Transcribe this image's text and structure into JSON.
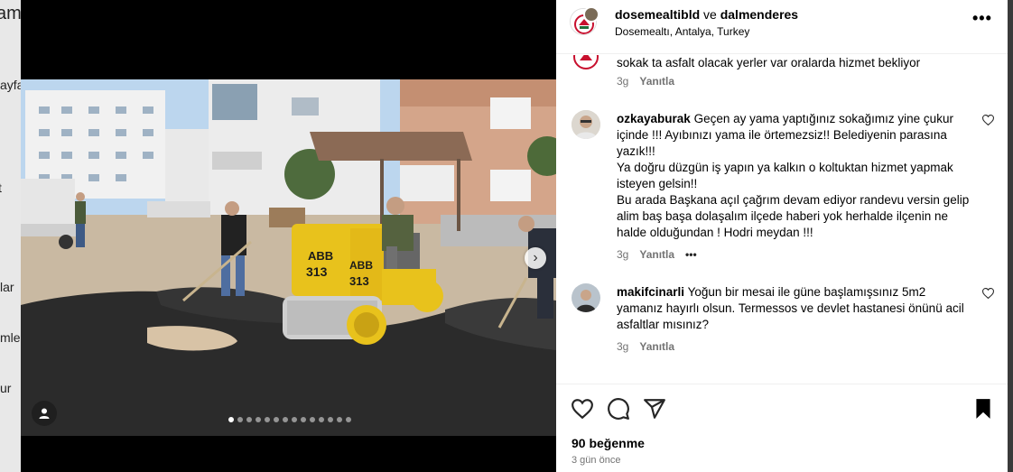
{
  "background": {
    "left_fragments": [
      "am",
      "ayfa",
      "t",
      "lar",
      "mle",
      "ur"
    ]
  },
  "post": {
    "header": {
      "author": "dosemealtibld",
      "connector": "ve",
      "collaborator": "dalmenderes",
      "location": "Dosemealtı, Antalya, Turkey",
      "more_label": "•••"
    },
    "carousel": {
      "slide_count": 14,
      "active_index": 0,
      "next_label": "›"
    },
    "comments": [
      {
        "username": "",
        "text": "sokak ta asfalt olacak yerler var oralarda hizmet bekliyor",
        "time": "3g",
        "reply_label": "Yanıtla"
      },
      {
        "username": "ozkayaburak",
        "text": "Geçen ay yama yaptığınız sokağımız yine çukur içinde !!! Ayıbınızı yama ile örtemezsiz!! Belediyenin parasına yazık!!!",
        "line2": "Ya doğru düzgün iş yapın ya kalkın o koltuktan hizmet yapmak isteyen gelsin!!",
        "line3": "Bu arada Başkana açıl çağrım devam ediyor randevu versin gelip alim baş başa dolaşalım ilçede haberi yok herhalde ilçenin ne halde olduğundan ! Hodri meydan !!!",
        "time": "3g",
        "reply_label": "Yanıtla",
        "more_label": "•••"
      },
      {
        "username": "makifcinarli",
        "text": "Yoğun bir mesai ile güne başlamışsınız 5m2 yamanız hayırlı olsun. Termessos ve devlet hastanesi önünü acil asfaltlar mısınız?",
        "time": "3g",
        "reply_label": "Yanıtla"
      }
    ],
    "photo": {
      "roller_label_1": "ABB",
      "roller_number_1": "313",
      "roller_label_2": "ABB",
      "roller_number_2": "313"
    },
    "likes": "90 beğenme",
    "date": "3 gün önce"
  },
  "colors": {
    "text": "#000000",
    "muted": "#737373",
    "roller_yellow": "#e8c21c",
    "asphalt": "#2b2b2b"
  }
}
